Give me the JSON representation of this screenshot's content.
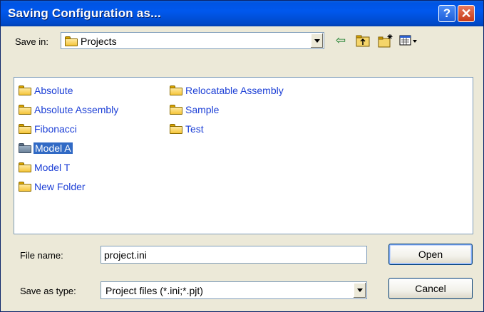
{
  "window": {
    "title": "Saving Configuration as...",
    "help_glyph": "?",
    "close_glyph": "✕"
  },
  "save_in": {
    "label": "Save in:",
    "value": "Projects",
    "icon": "folder-icon"
  },
  "toolbar": {
    "back_glyph": "⇦",
    "up_glyph": "⬆",
    "new_folder_glyph": "✱",
    "view_menu_glyph": "▦▾"
  },
  "folders": {
    "col1": [
      {
        "name": "Absolute"
      },
      {
        "name": "Absolute Assembly"
      },
      {
        "name": "Fibonacci"
      },
      {
        "name": "Model A",
        "selected": true
      },
      {
        "name": "Model T"
      },
      {
        "name": "New Folder"
      }
    ],
    "col2": [
      {
        "name": "Relocatable Assembly"
      },
      {
        "name": "Sample"
      },
      {
        "name": "Test"
      }
    ]
  },
  "file_name": {
    "label": "File name:",
    "value": "project.ini"
  },
  "save_as_type": {
    "label": "Save as type:",
    "value": "Project files (*.ini;*.pjt)"
  },
  "buttons": {
    "open": "Open",
    "cancel": "Cancel"
  },
  "colors": {
    "titlebar": "#0054e3",
    "selection": "#316ac5",
    "folder_text": "#1c3fd6",
    "dialog_bg": "#ece9d8"
  }
}
